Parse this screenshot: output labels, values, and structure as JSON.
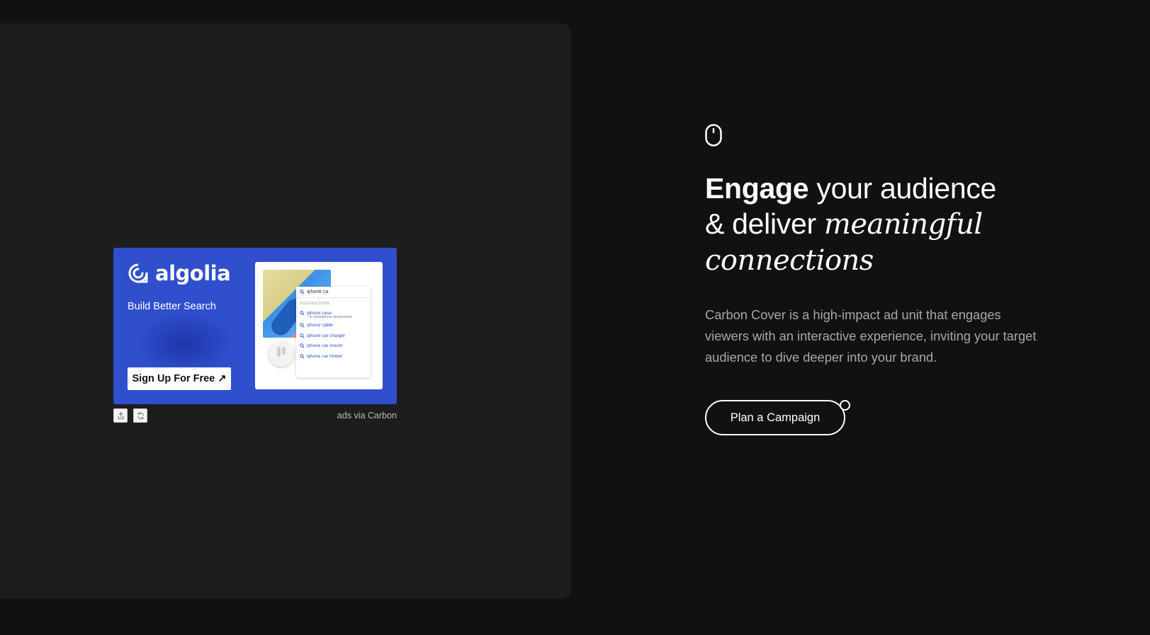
{
  "ad": {
    "brand_name": "algolia",
    "tagline": "Build Better Search",
    "cta_label": "Sign Up For Free",
    "cta_arrow": "↗",
    "footer_text": "ads via Carbon",
    "screenshot": {
      "search_query": "iphone ca",
      "suggestions_header": "SUGGESTIONS",
      "suggestions": [
        {
          "label": "iphone case",
          "sub": "› in smartphone accessories"
        },
        {
          "label": "iphone cable",
          "sub": ""
        },
        {
          "label": "iphone car charger",
          "sub": ""
        },
        {
          "label": "iphone car mount",
          "sub": ""
        },
        {
          "label": "iphone car holder",
          "sub": ""
        }
      ]
    },
    "colors": {
      "card_bg": "#2f4fcd",
      "cta_bg": "#ffffff"
    }
  },
  "hero": {
    "headline": {
      "part1": "Engage",
      "part2": " your audience",
      "part3": "& deliver ",
      "part4": "meaningful",
      "part5": "connections"
    },
    "description": "Carbon Cover is a high-impact ad unit that engages viewers with an interactive experience, inviting your target audience to dive deeper into your brand.",
    "button_label": "Plan a Campaign"
  },
  "icons": {
    "hero": "mouse-icon",
    "ad_tools": [
      "share-icon",
      "refresh-icon"
    ]
  },
  "colors": {
    "page_bg": "#111111",
    "panel_bg": "#1d1d1d",
    "text_muted": "#a8a8a8"
  }
}
